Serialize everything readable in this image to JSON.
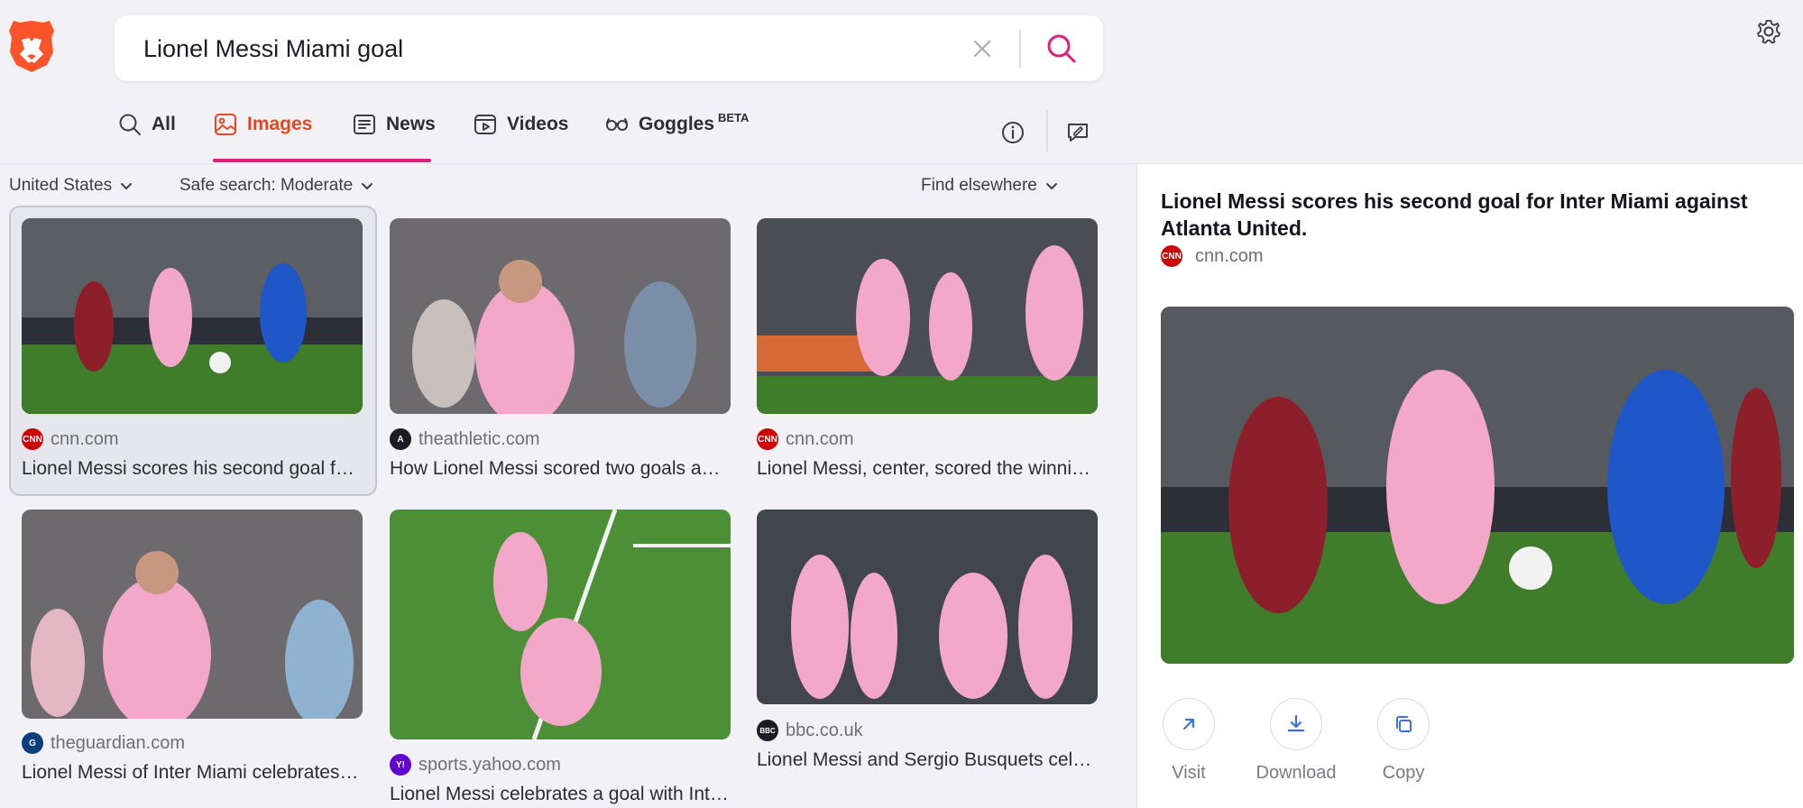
{
  "search": {
    "query": "Lionel Messi Miami goal",
    "placeholder": ""
  },
  "tabs": [
    {
      "label": "All",
      "icon": "search-icon",
      "active": false
    },
    {
      "label": "Images",
      "icon": "image-icon",
      "active": true
    },
    {
      "label": "News",
      "icon": "news-icon",
      "active": false
    },
    {
      "label": "Videos",
      "icon": "video-icon",
      "active": false
    },
    {
      "label": "Goggles",
      "badge": "BETA",
      "icon": "goggles-icon",
      "active": false
    }
  ],
  "filters": {
    "region": "United States",
    "safe_search": "Safe search: Moderate",
    "find_elsewhere": "Find elsewhere"
  },
  "results": [
    {
      "source": "cnn.com",
      "caption": "Lionel Messi scores his second goal for Inter Miami against Atlanta United.",
      "favicon": "cnn"
    },
    {
      "source": "theathletic.com",
      "caption": "How Lionel Messi scored two goals against Atlanta United",
      "favicon": "athletic"
    },
    {
      "source": "cnn.com",
      "caption": "Lionel Messi, center, scored the winning goal for Inter Miami",
      "favicon": "cnn"
    },
    {
      "source": "theguardian.com",
      "caption": "Lionel Messi of Inter Miami celebrates a goal",
      "favicon": "guardian"
    },
    {
      "source": "sports.yahoo.com",
      "caption": "Lionel Messi celebrates a goal with Inter Miami teammates",
      "favicon": "yahoo"
    },
    {
      "source": "bbc.co.uk",
      "caption": "Lionel Messi and Sergio Busquets celebrate",
      "favicon": "bbc"
    }
  ],
  "panel": {
    "title": "Lionel Messi scores his second goal for Inter Miami against Atlanta United.",
    "source": "cnn.com",
    "actions": {
      "visit": "Visit",
      "download": "Download",
      "copy": "Copy"
    }
  },
  "colors": {
    "accent": "#e0207a",
    "active_tab": "#e8461f",
    "brave_orange": "#fb542b",
    "jersey_pink": "#f3a8c9",
    "pitch_green": "#3f7d2b",
    "cnn_red": "#cc0000"
  }
}
